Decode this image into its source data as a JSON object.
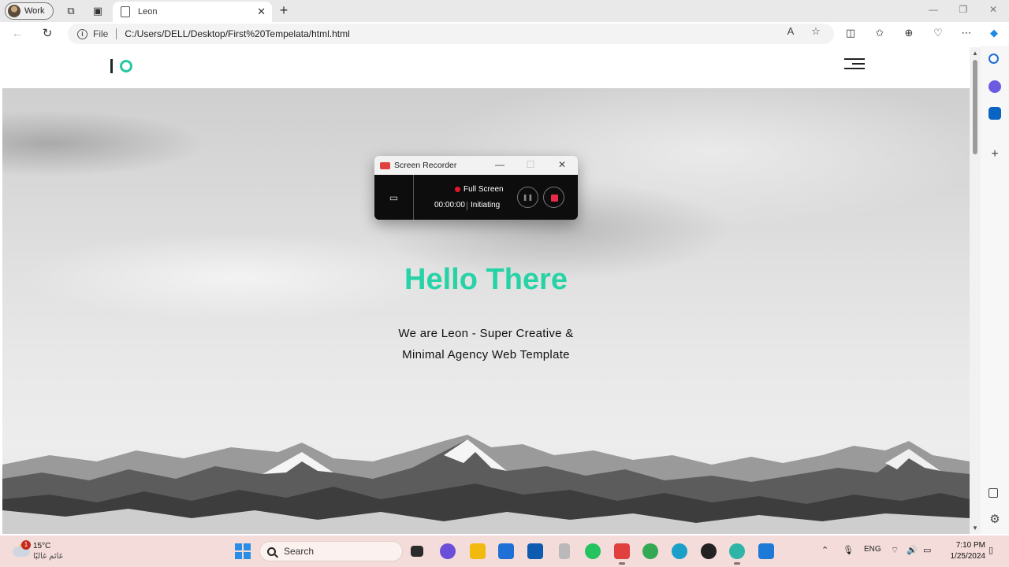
{
  "browser": {
    "profile_label": "Work",
    "tab_title": "Leon",
    "new_tab": "+",
    "address_scheme": "File",
    "address_url": "C:/Users/DELL/Desktop/First%20Tempelata/html.html"
  },
  "page": {
    "hero_title": "Hello There",
    "hero_subtitle_line1": "We are Leon - Super Creative &",
    "hero_subtitle_line2": "Minimal Agency Web Template",
    "colors": {
      "accent": "#27d3a6",
      "logo_dark": "#1b2a2a"
    }
  },
  "recorder": {
    "title": "Screen Recorder",
    "mode": "Full Screen",
    "time": "00:00:00",
    "state": "Initiating",
    "colors": {
      "stop": "#e8294a",
      "record_dot": "#e0182a"
    }
  },
  "taskbar": {
    "weather_temp": "15°C",
    "weather_desc": "غائم غالبًا",
    "weather_badge": "1",
    "search_label": "Search",
    "language": "ENG",
    "time": "7:10 PM",
    "date": "1/25/2024",
    "colors": {
      "background": "#f3dcd9"
    }
  }
}
